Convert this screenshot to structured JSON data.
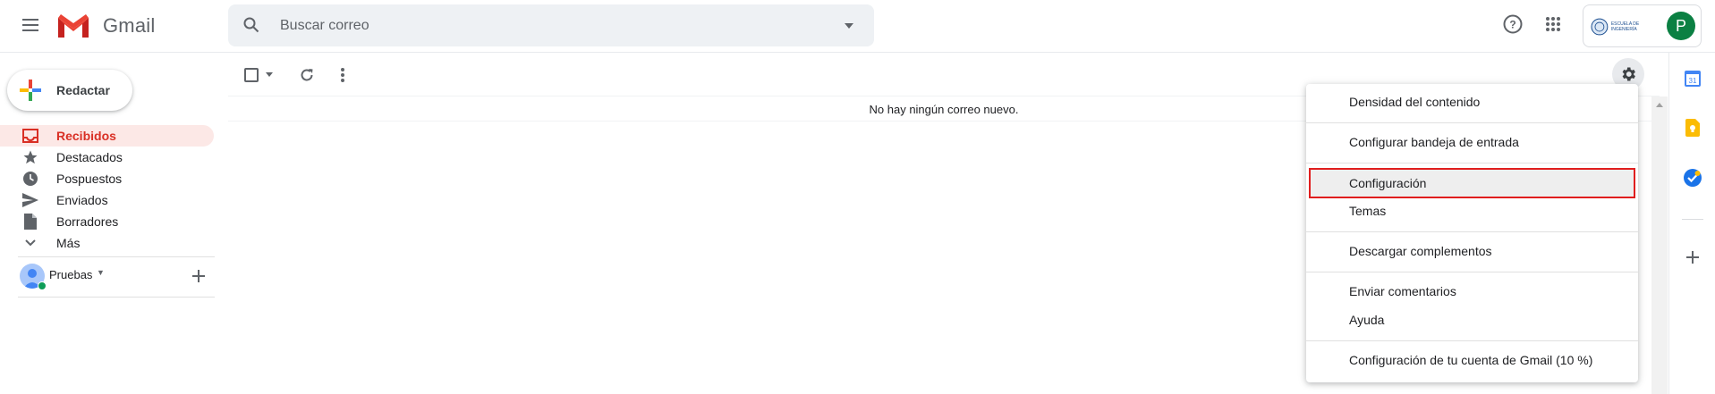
{
  "header": {
    "app_name": "Gmail",
    "search_placeholder": "Buscar correo",
    "account_initial": "P",
    "org_logo_text": "ESCUELA DE INGENIERÍA"
  },
  "sidebar": {
    "compose_label": "Redactar",
    "items": [
      {
        "label": "Recibidos",
        "icon": "inbox-icon",
        "active": true
      },
      {
        "label": "Destacados",
        "icon": "star-icon"
      },
      {
        "label": "Pospuestos",
        "icon": "clock-icon"
      },
      {
        "label": "Enviados",
        "icon": "send-icon"
      },
      {
        "label": "Borradores",
        "icon": "draft-icon"
      },
      {
        "label": "Más",
        "icon": "chevron-down-icon"
      }
    ],
    "labels_user": "Pruebas"
  },
  "main": {
    "empty_message": "No hay ningún correo nuevo."
  },
  "settings_menu": {
    "items": [
      "Densidad del contenido",
      "Configurar bandeja de entrada",
      "Configuración",
      "Temas",
      "Descargar complementos",
      "Enviar comentarios",
      "Ayuda",
      "Configuración de tu cuenta de Gmail (10 %)"
    ],
    "highlighted": "Configuración"
  },
  "colors": {
    "accent_red": "#d93025",
    "active_bg": "#fce8e6",
    "avatar_green": "#0b8043",
    "highlight_outline": "#e01e1e"
  }
}
